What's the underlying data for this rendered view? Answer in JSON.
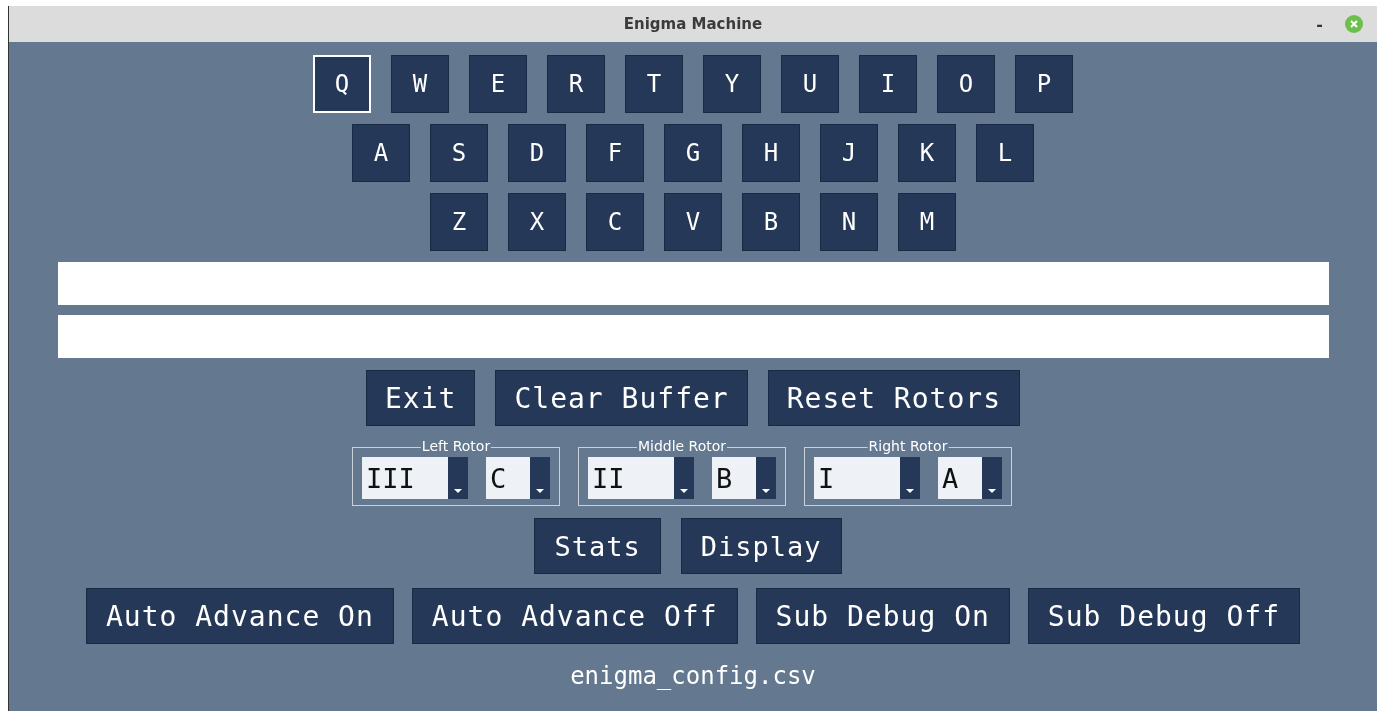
{
  "window": {
    "title": "Enigma Machine",
    "controls": [
      "-"
    ]
  },
  "keyboard": [
    [
      {
        "label": "Q",
        "focused": true
      },
      {
        "label": "W",
        "focused": false
      },
      {
        "label": "E",
        "focused": false
      },
      {
        "label": "R",
        "focused": false
      },
      {
        "label": "T",
        "focused": false
      },
      {
        "label": "Y",
        "focused": false
      },
      {
        "label": "U",
        "focused": false
      },
      {
        "label": "I",
        "focused": false
      },
      {
        "label": "O",
        "focused": false
      },
      {
        "label": "P",
        "focused": false
      }
    ],
    [
      {
        "label": "A",
        "focused": false
      },
      {
        "label": "S",
        "focused": false
      },
      {
        "label": "D",
        "focused": false
      },
      {
        "label": "F",
        "focused": false
      },
      {
        "label": "G",
        "focused": false
      },
      {
        "label": "H",
        "focused": false
      },
      {
        "label": "J",
        "focused": false
      },
      {
        "label": "K",
        "focused": false
      },
      {
        "label": "L",
        "focused": false
      }
    ],
    [
      {
        "label": "Z",
        "focused": false
      },
      {
        "label": "X",
        "focused": false
      },
      {
        "label": "C",
        "focused": false
      },
      {
        "label": "V",
        "focused": false
      },
      {
        "label": "B",
        "focused": false
      },
      {
        "label": "N",
        "focused": false
      },
      {
        "label": "M",
        "focused": false
      }
    ]
  ],
  "fields": [
    {
      "kind": "text"
    },
    {
      "kind": "text"
    }
  ],
  "actions": [
    "Exit",
    "Clear Buffer",
    "Reset Rotors"
  ],
  "rotors": [
    {
      "label": "Left Rotor",
      "wheel": "III",
      "position": "C"
    },
    {
      "label": "Middle Rotor",
      "wheel": "II",
      "position": "B"
    },
    {
      "label": "Right Rotor",
      "wheel": "I",
      "position": "A"
    }
  ],
  "views": [
    "Stats",
    "Display"
  ],
  "modes": [
    "Auto Advance On",
    "Auto Advance Off",
    "Sub Debug On",
    "Sub Debug Off"
  ],
  "status": "enigma_config.csv"
}
